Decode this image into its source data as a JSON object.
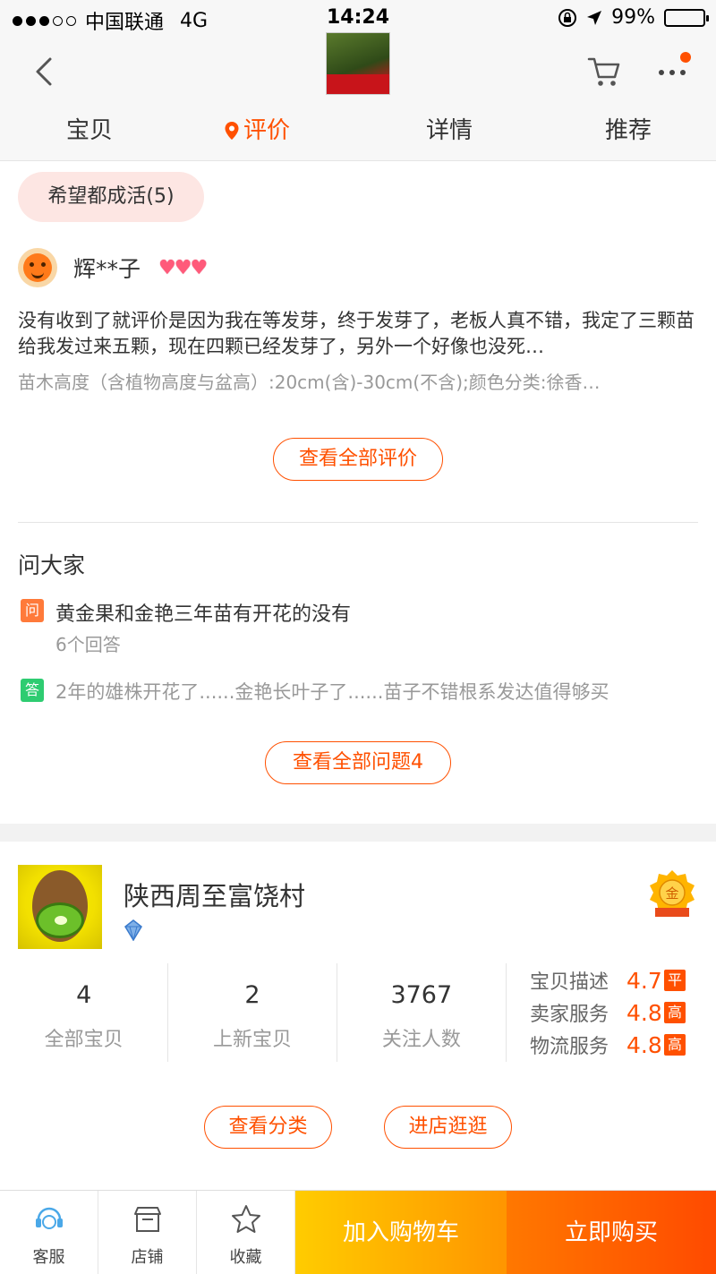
{
  "status_bar": {
    "carrier": "中国联通",
    "network": "4G",
    "time": "14:24",
    "battery": "99%"
  },
  "nav": {
    "tabs": [
      {
        "label": "宝贝",
        "active": false
      },
      {
        "label": "评价",
        "active": true
      },
      {
        "label": "详情",
        "active": false
      },
      {
        "label": "推荐",
        "active": false
      }
    ],
    "icons": [
      "back-icon",
      "cart-icon",
      "more-icon"
    ]
  },
  "reviews": {
    "tag": "希望都成活(5)",
    "reviewer_name": "辉**子",
    "text": "没有收到了就评价是因为我在等发芽，终于发芽了，老板人真不错，我定了三颗苗给我发过来五颗，现在四颗已经发芽了，另外一个好像也没死…",
    "spec": "苗木高度（含植物高度与盆高）:20cm(含)-30cm(不含);颜色分类:徐香…",
    "view_all": "查看全部评价"
  },
  "ask": {
    "title": "问大家",
    "q_badge": "问",
    "question": "黄金果和金艳三年苗有开花的没有",
    "answer_count": "6个回答",
    "a_badge": "答",
    "answer": "2年的雄株开花了......金艳长叶子了......苗子不错根系发达值得够买",
    "view_all": "查看全部问题4"
  },
  "shop": {
    "name": "陕西周至富饶村",
    "medal_text": "金",
    "stats": [
      {
        "value": "4",
        "label": "全部宝贝"
      },
      {
        "value": "2",
        "label": "上新宝贝"
      },
      {
        "value": "3767",
        "label": "关注人数"
      }
    ],
    "ratings": [
      {
        "label": "宝贝描述",
        "value": "4.7",
        "level": "平"
      },
      {
        "label": "卖家服务",
        "value": "4.8",
        "level": "高"
      },
      {
        "label": "物流服务",
        "value": "4.8",
        "level": "高"
      }
    ],
    "view_categories": "查看分类",
    "enter_shop": "进店逛逛"
  },
  "bottom_bar": {
    "service": "客服",
    "shop": "店铺",
    "favorite": "收藏",
    "add_to_cart": "加入购物车",
    "buy_now": "立即购买"
  },
  "colors": {
    "accent": "#ff5000",
    "cart_gradient": "#ffa500",
    "buy_gradient": "#ff5000"
  }
}
